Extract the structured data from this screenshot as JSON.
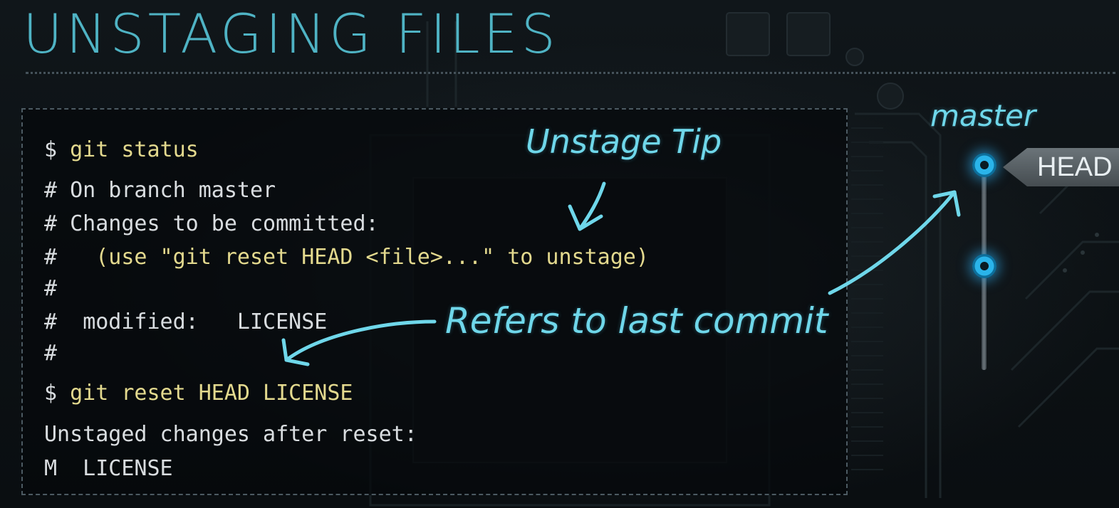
{
  "title": "UNSTAGING FILES",
  "terminal": {
    "lines": [
      {
        "prefix": "$ ",
        "text": "git status",
        "style": "command"
      },
      {
        "prefix": "# ",
        "text": "On branch master",
        "style": "output"
      },
      {
        "prefix": "# ",
        "text": "Changes to be committed:",
        "style": "output"
      },
      {
        "prefix": "#   ",
        "text": "(use \"git reset HEAD <file>...\" to unstage)",
        "style": "hint"
      },
      {
        "prefix": "#",
        "text": "",
        "style": "output"
      },
      {
        "prefix": "#  ",
        "text": "modified:   LICENSE",
        "style": "output"
      },
      {
        "prefix": "#",
        "text": "",
        "style": "output"
      },
      {
        "prefix": "$ ",
        "text": "git reset HEAD LICENSE",
        "style": "command"
      },
      {
        "prefix": "",
        "text": "Unstaged changes after reset:",
        "style": "output"
      },
      {
        "prefix": "",
        "text": "M  LICENSE",
        "style": "output"
      }
    ]
  },
  "annotations": {
    "unstage_tip": "Unstage Tip",
    "refers_to_last_commit": "Refers to last commit"
  },
  "graph": {
    "branch_label": "master",
    "head_label": "HEAD"
  },
  "colors": {
    "title": "#4fb3c4",
    "command": "#e3d98e",
    "output": "#d9dde0",
    "annotation": "#6fd7ea",
    "commit_node": "#2ab4ea"
  }
}
